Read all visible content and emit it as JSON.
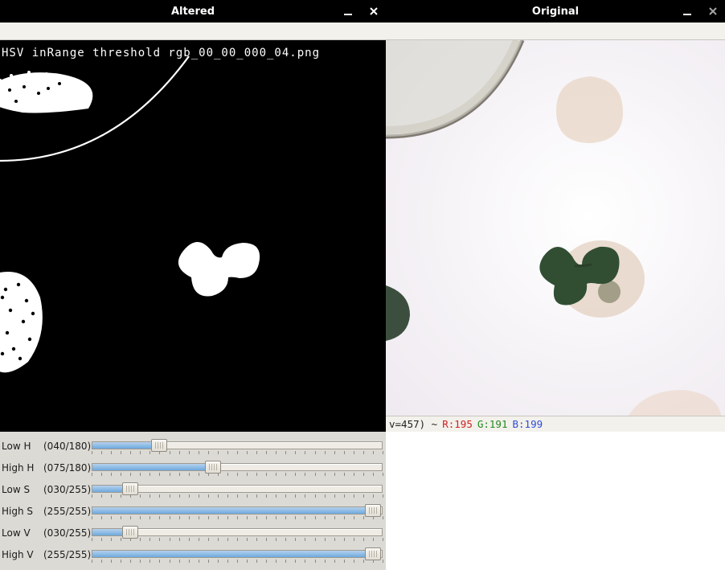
{
  "windows": {
    "altered": {
      "title": "Altered"
    },
    "original": {
      "title": "Original"
    }
  },
  "overlay_filename": "HSV inRange threshold rgb_00_00_000_04.png",
  "sliders": {
    "low_h": {
      "label": "Low H",
      "value": 40,
      "max": 180,
      "display": "(040/180)"
    },
    "high_h": {
      "label": "High H",
      "value": 75,
      "max": 180,
      "display": "(075/180)"
    },
    "low_s": {
      "label": "Low S",
      "value": 30,
      "max": 255,
      "display": "(030/255)"
    },
    "high_s": {
      "label": "High S",
      "value": 255,
      "max": 255,
      "display": "(255/255)"
    },
    "low_v": {
      "label": "Low V",
      "value": 30,
      "max": 255,
      "display": "(030/255)"
    },
    "high_v": {
      "label": "High V",
      "value": 255,
      "max": 255,
      "display": "(255/255)"
    }
  },
  "status": {
    "coord": "v=457) ~",
    "r": "R:195",
    "g": "G:191",
    "b": "B:199"
  }
}
